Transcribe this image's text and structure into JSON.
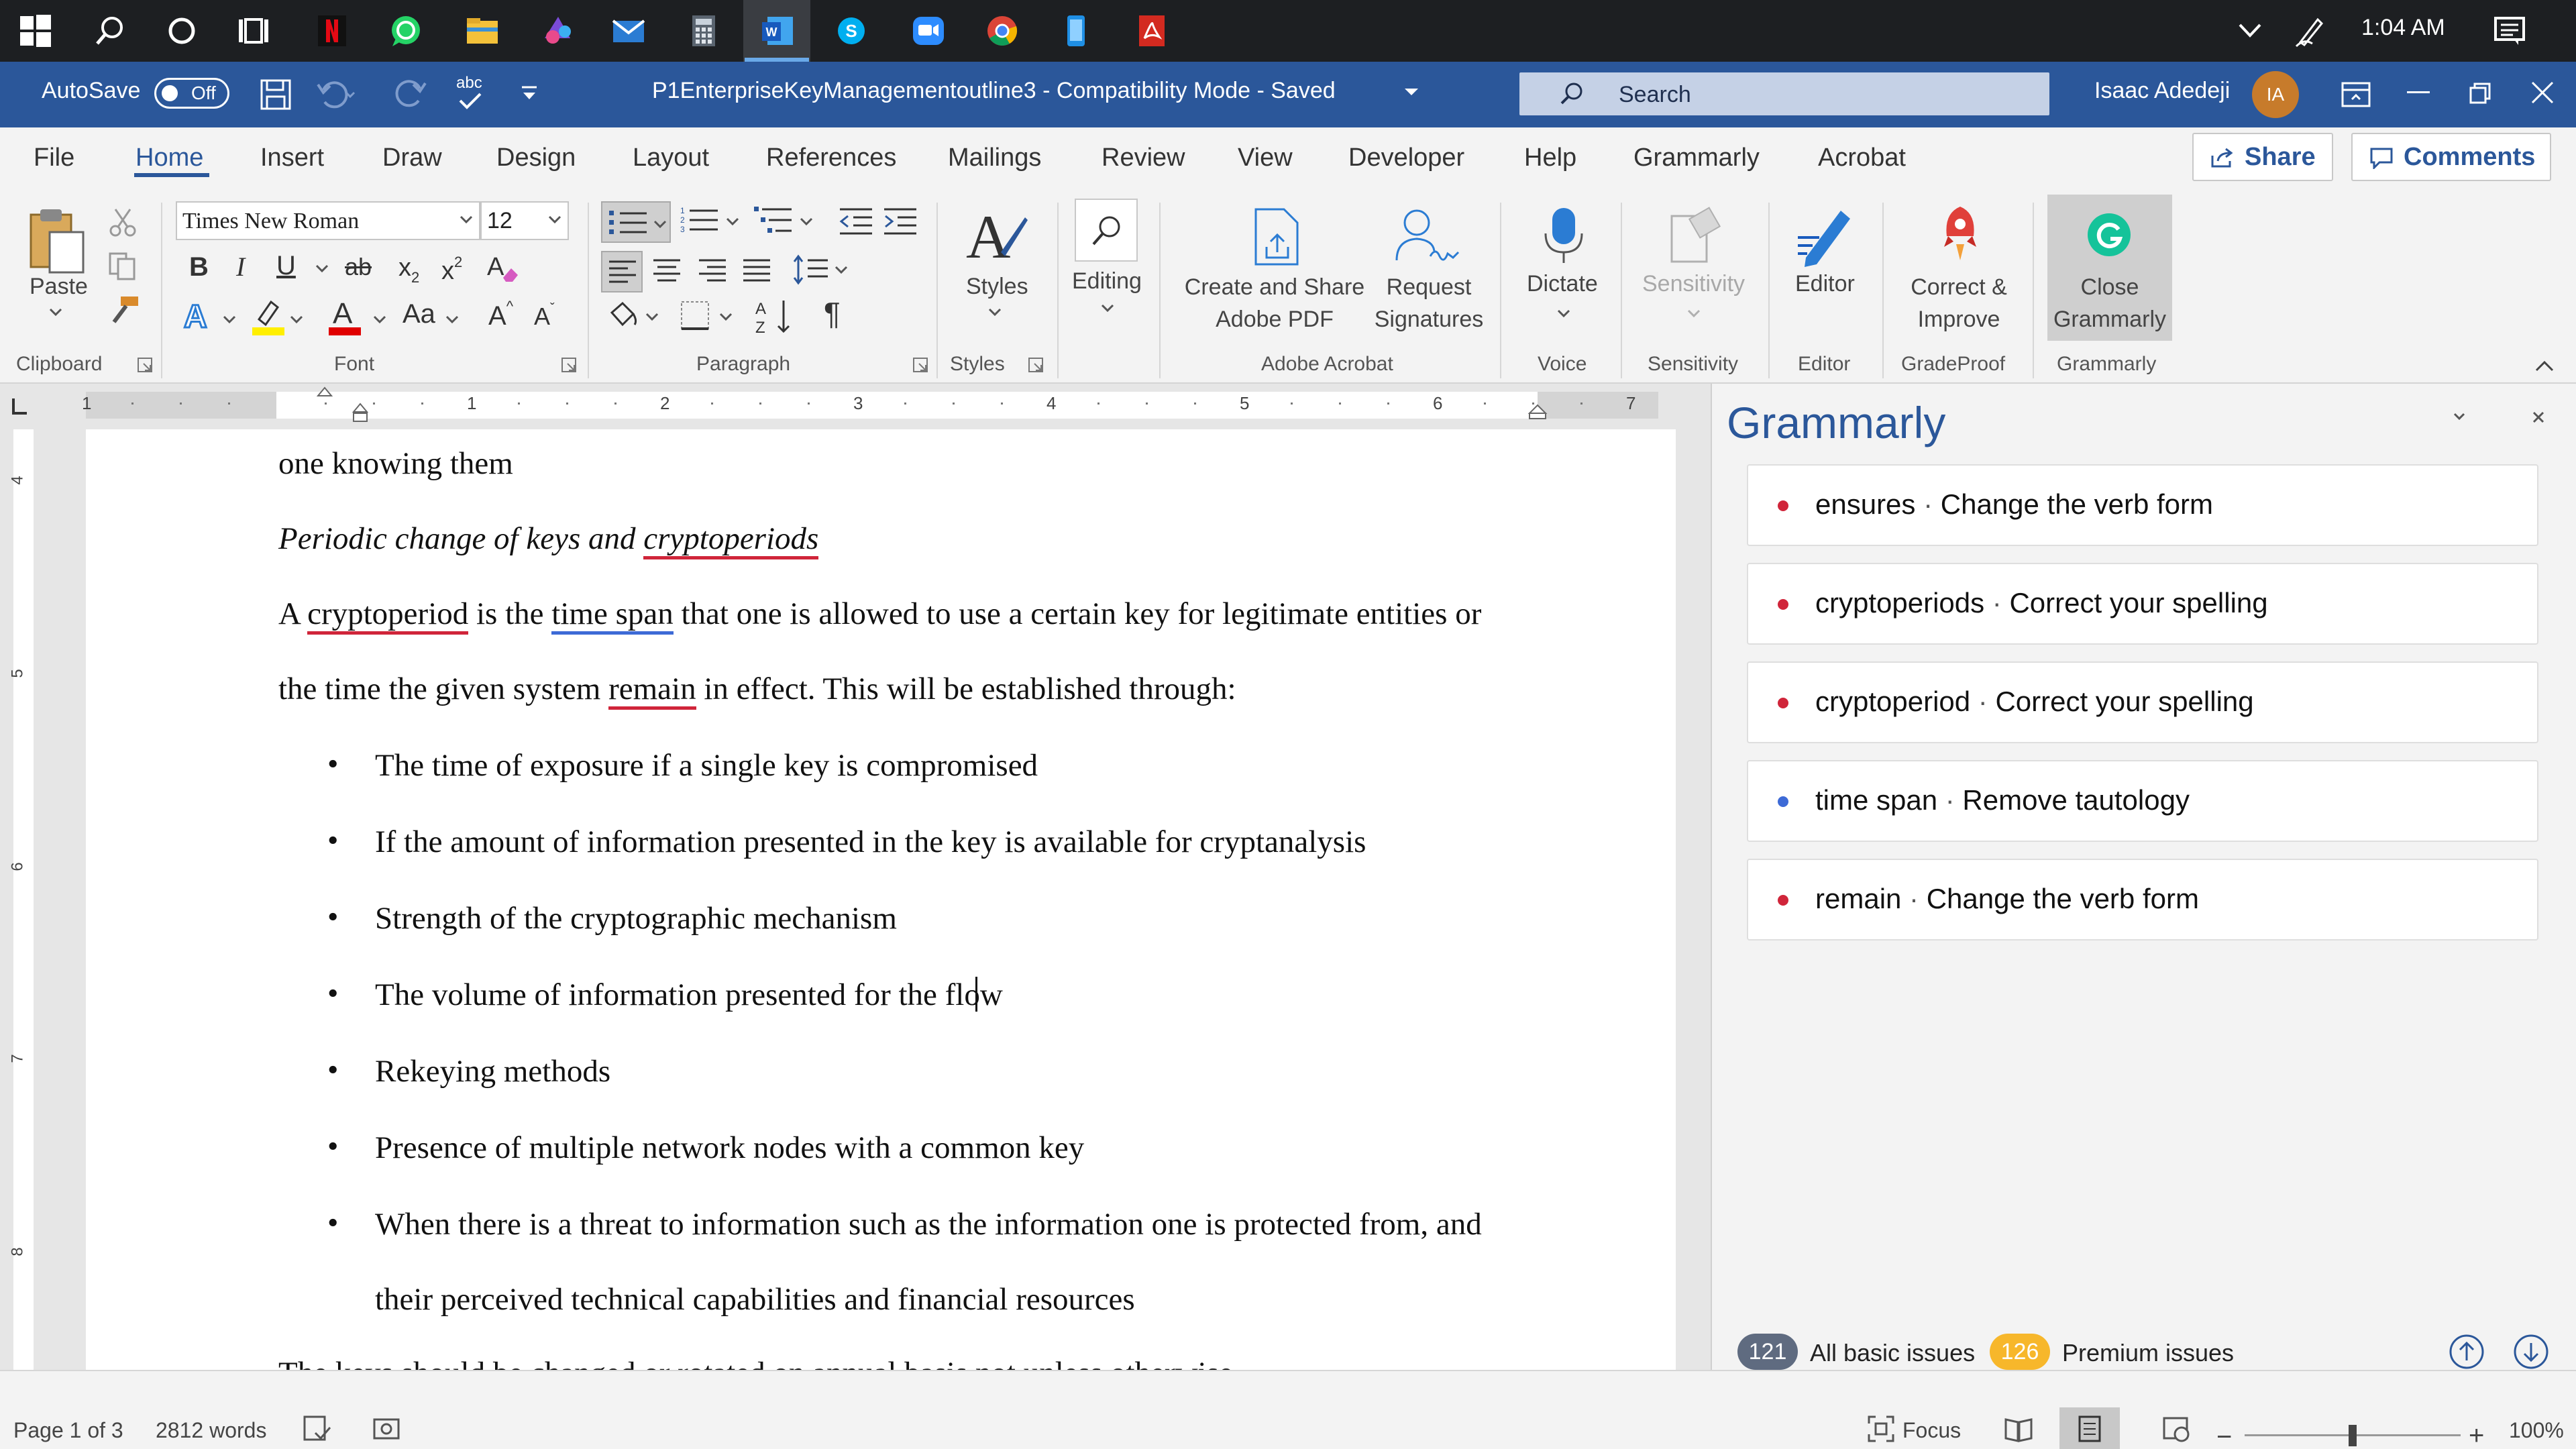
{
  "taskbar": {
    "time": "1:04 AM",
    "icons": [
      "windows-icon",
      "search-icon",
      "cortana-icon",
      "task-view-icon",
      "netflix-icon",
      "whatsapp-icon",
      "file-explorer-icon",
      "paint-icon",
      "mail-icon",
      "calculator-icon",
      "word-icon",
      "skype-icon",
      "zoom-icon",
      "chrome-icon",
      "phone-icon",
      "acrobat-icon"
    ]
  },
  "titlebar": {
    "autosave_label": "AutoSave",
    "autosave_state": "Off",
    "document_title": "P1EnterpriseKeyManagementoutline3  -  Compatibility Mode  -  Saved",
    "search_placeholder": "Search",
    "user_name": "Isaac Adedeji",
    "user_initials": "IA",
    "spell_label": "abc"
  },
  "tabs": [
    "File",
    "Home",
    "Insert",
    "Draw",
    "Design",
    "Layout",
    "References",
    "Mailings",
    "Review",
    "View",
    "Developer",
    "Help",
    "Grammarly",
    "Acrobat"
  ],
  "active_tab": "Home",
  "share_label": "Share",
  "comments_label": "Comments",
  "ribbon": {
    "clipboard": {
      "paste": "Paste",
      "group": "Clipboard"
    },
    "font": {
      "name": "Times New Roman",
      "size": "12",
      "group": "Font",
      "bold": "B",
      "italic": "I",
      "underline": "U",
      "strike": "ab",
      "sub": "x",
      "sub_mark": "2",
      "sup": "x",
      "sup_mark": "2",
      "change_case": "Aa",
      "grow": "A",
      "shrink": "A",
      "font_color_letter": "A",
      "effects_letter": "A"
    },
    "paragraph": {
      "group": "Paragraph",
      "pilcrow": "¶"
    },
    "styles": {
      "label": "Styles",
      "group": "Styles"
    },
    "editing": {
      "label": "Editing"
    },
    "acrobat": {
      "create_line1": "Create and Share",
      "create_line2": "Adobe PDF",
      "request_line1": "Request",
      "request_line2": "Signatures",
      "group": "Adobe Acrobat"
    },
    "voice": {
      "dictate": "Dictate",
      "group": "Voice"
    },
    "sensitivity": {
      "label": "Sensitivity",
      "group": "Sensitivity"
    },
    "editor": {
      "label": "Editor",
      "group": "Editor"
    },
    "gradeproof": {
      "line1": "Correct &",
      "line2": "Improve",
      "group": "GradeProof"
    },
    "grammarly": {
      "line1": "Close",
      "line2": "Grammarly",
      "group": "Grammarly"
    }
  },
  "ruler": {
    "numbers": [
      "1",
      "1",
      "2",
      "3",
      "4",
      "5",
      "6",
      "7"
    ],
    "vertical": [
      "4",
      "5",
      "6",
      "7",
      "8"
    ]
  },
  "document": {
    "lines": [
      {
        "text": "one knowing them"
      },
      {
        "italic_prefix": "Periodic change of keys and ",
        "italic_flag": "cryptoperiods"
      },
      {
        "p1": "A ",
        "flag1": "cryptoperiod",
        "p2": " is the ",
        "flag2": "time span",
        "p3": " that one is allowed to use a certain key for legitimate entities or"
      },
      {
        "p1": "the time the given system ",
        "flag1": "remain",
        "p2": " in effect. This will be established through:"
      }
    ],
    "bullets": [
      "The time of exposure if a single key is compromised",
      "If the amount of information presented in the key is available for cryptanalysis",
      "Strength of the cryptographic mechanism",
      "The volume of information presented for the flow",
      "Rekeying methods",
      "Presence of multiple network nodes with a common key",
      "When there is a threat to information such as the information one is protected from, and"
    ],
    "continuation": "their perceived technical capabilities and financial resources",
    "cut_line": "The keys should be changed or rotated on annual basis not unless otherwise"
  },
  "grammarly_panel": {
    "title": "Grammarly",
    "suggestions": [
      {
        "word": "ensures",
        "hint": "Change the verb form",
        "color": "#d0253a"
      },
      {
        "word": "cryptoperiods",
        "hint": "Correct your spelling",
        "color": "#d0253a"
      },
      {
        "word": "cryptoperiod",
        "hint": "Correct your spelling",
        "color": "#d0253a"
      },
      {
        "word": "time span",
        "hint": "Remove tautology",
        "color": "#3d6ad6"
      },
      {
        "word": "remain",
        "hint": "Change the verb form",
        "color": "#d0253a"
      }
    ],
    "basic_count": "121",
    "basic_label": "All basic issues",
    "premium_count": "126",
    "premium_label": "Premium issues"
  },
  "status": {
    "page": "Page 1 of 3",
    "words": "2812 words",
    "focus": "Focus",
    "zoom": "100%",
    "zoom_level": 0.5
  },
  "colors": {
    "accent": "#2b579a",
    "taskbar": "#1d1f22",
    "flag_red": "#d0253a",
    "flag_blue": "#3d6ad6",
    "premium": "#f7b72b"
  }
}
